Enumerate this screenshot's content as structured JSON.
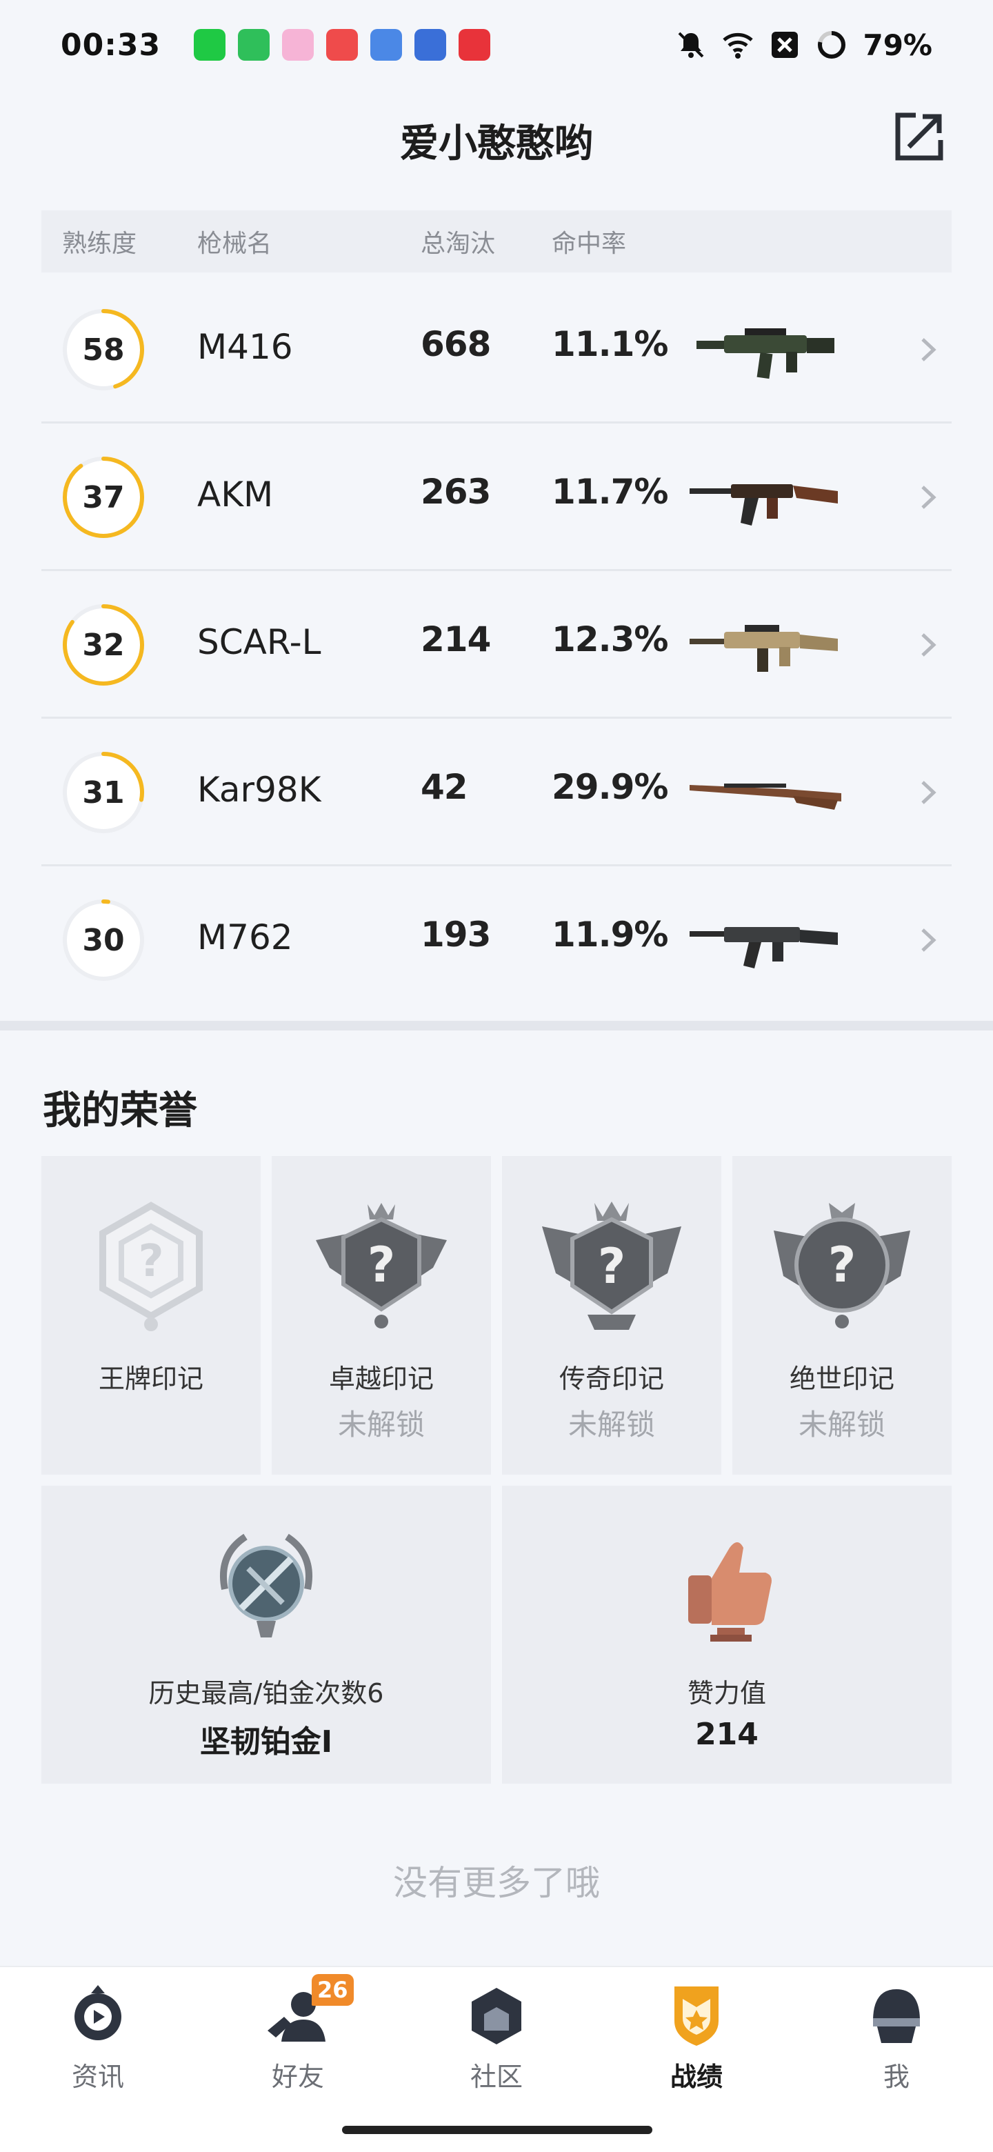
{
  "status_bar": {
    "time": "00:33",
    "battery": "79%",
    "app_colors": [
      "#1fc944",
      "#2fbf5a",
      "#f3a8d0",
      "#ef4b4b",
      "#3c7be0",
      "#3a6fd8",
      "#e8333a"
    ]
  },
  "header": {
    "title": "爱小憨憨哟"
  },
  "table": {
    "headers": [
      "熟练度",
      "枪械名",
      "总淘汰",
      "命中率"
    ],
    "rows": [
      {
        "level": "58",
        "progress": 0.45,
        "name": "M416",
        "kills": "668",
        "rate": "11.1%",
        "gun_icon": "m416-rifle-icon"
      },
      {
        "level": "37",
        "progress": 0.9,
        "name": "AKM",
        "kills": "263",
        "rate": "11.7%",
        "gun_icon": "akm-rifle-icon"
      },
      {
        "level": "32",
        "progress": 0.85,
        "name": "SCAR-L",
        "kills": "214",
        "rate": "12.3%",
        "gun_icon": "scarl-rifle-icon"
      },
      {
        "level": "31",
        "progress": 0.28,
        "name": "Kar98K",
        "kills": "42",
        "rate": "29.9%",
        "gun_icon": "kar98k-rifle-icon"
      },
      {
        "level": "30",
        "progress": 0.02,
        "name": "M762",
        "kills": "193",
        "rate": "11.9%",
        "gun_icon": "m762-rifle-icon"
      }
    ]
  },
  "honors": {
    "title": "我的荣誉",
    "badges": [
      {
        "label": "王牌印记",
        "sub": ""
      },
      {
        "label": "卓越印记",
        "sub": "未解锁"
      },
      {
        "label": "传奇印记",
        "sub": "未解锁"
      },
      {
        "label": "绝世印记",
        "sub": "未解锁"
      }
    ],
    "cards": [
      {
        "label": "历史最高/铂金次数6",
        "value": "坚韧铂金Ⅰ"
      },
      {
        "label": "赞力值",
        "value": "214"
      }
    ]
  },
  "footer": {
    "no_more": "没有更多了哦"
  },
  "nav": {
    "items": [
      {
        "label": "资讯",
        "icon": "news-icon"
      },
      {
        "label": "好友",
        "icon": "friends-icon",
        "badge": "26"
      },
      {
        "label": "社区",
        "icon": "community-icon"
      },
      {
        "label": "战绩",
        "icon": "record-icon",
        "active": true
      },
      {
        "label": "我",
        "icon": "profile-icon"
      }
    ]
  },
  "colors": {
    "ring": "#f5b820",
    "ring_track": "#eceef2",
    "accent": "#f0a21e"
  }
}
